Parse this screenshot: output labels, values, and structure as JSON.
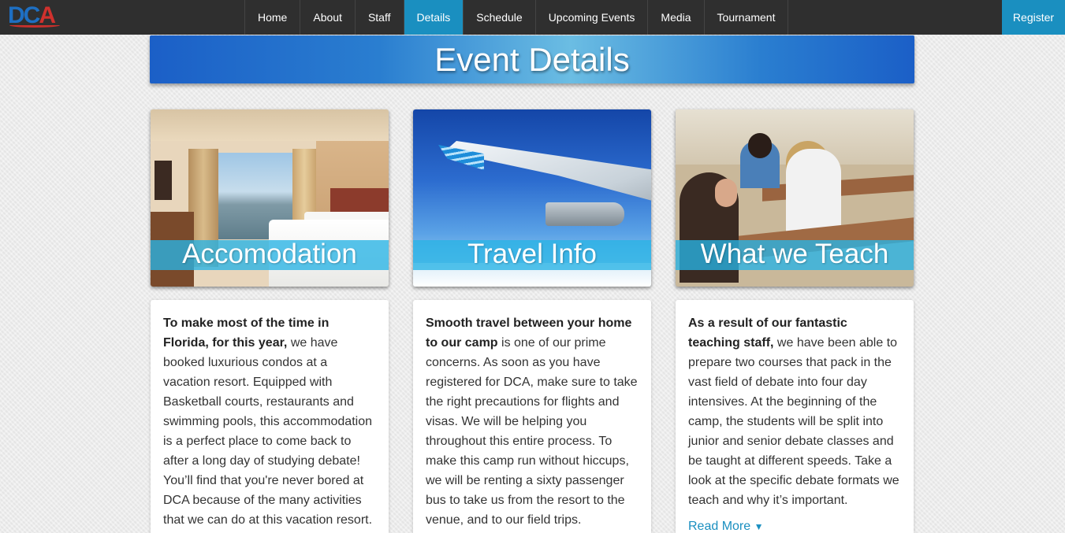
{
  "nav": {
    "logo": {
      "part1": "D",
      "part2": "C",
      "part3": "A"
    },
    "items": [
      {
        "label": "Home"
      },
      {
        "label": "About"
      },
      {
        "label": "Staff"
      },
      {
        "label": "Details",
        "active": true
      },
      {
        "label": "Schedule"
      },
      {
        "label": "Upcoming Events"
      },
      {
        "label": "Media"
      },
      {
        "label": "Tournament"
      }
    ],
    "register_label": "Register"
  },
  "banner": {
    "title": "Event Details"
  },
  "cards": [
    {
      "caption": "Accomodation",
      "bold": "To make most of the time in Florida, for this year,",
      "text": " we have booked luxurious condos at a vacation resort. Equipped with Basketball courts, restaurants and swimming pools, this accommodation is a perfect place to come back to after a long day of studying debate! You’ll find that you're never bored at DCA because of the many activities that we can do at this vacation resort."
    },
    {
      "caption": "Travel Info",
      "bold": "Smooth travel between your home to our camp",
      "text": " is one of our prime concerns. As soon as you have registered for DCA, make sure to take the right precautions for flights and visas. We will be helping you throughout this entire process. To make this camp run without hiccups, we will be renting a sixty passenger bus to take us from the resort to the venue, and to our field trips."
    },
    {
      "caption": "What we Teach",
      "bold": "As a result of our fantastic teaching staff,",
      "text": " we have been able to prepare two courses that pack in the vast field of debate into four day intensives. At the beginning of the camp, the students will be split into junior and senior debate classes and be taught at different speeds. Take a look at the specific debate formats we teach and why it’s important.",
      "read_more": "Read More",
      "read_more_icon": "caret-down-icon"
    }
  ],
  "colors": {
    "nav_bg": "#2f2f2f",
    "accent": "#1a8fc0",
    "banner_dark": "#1b5fc7",
    "banner_light": "#6bbde3"
  }
}
